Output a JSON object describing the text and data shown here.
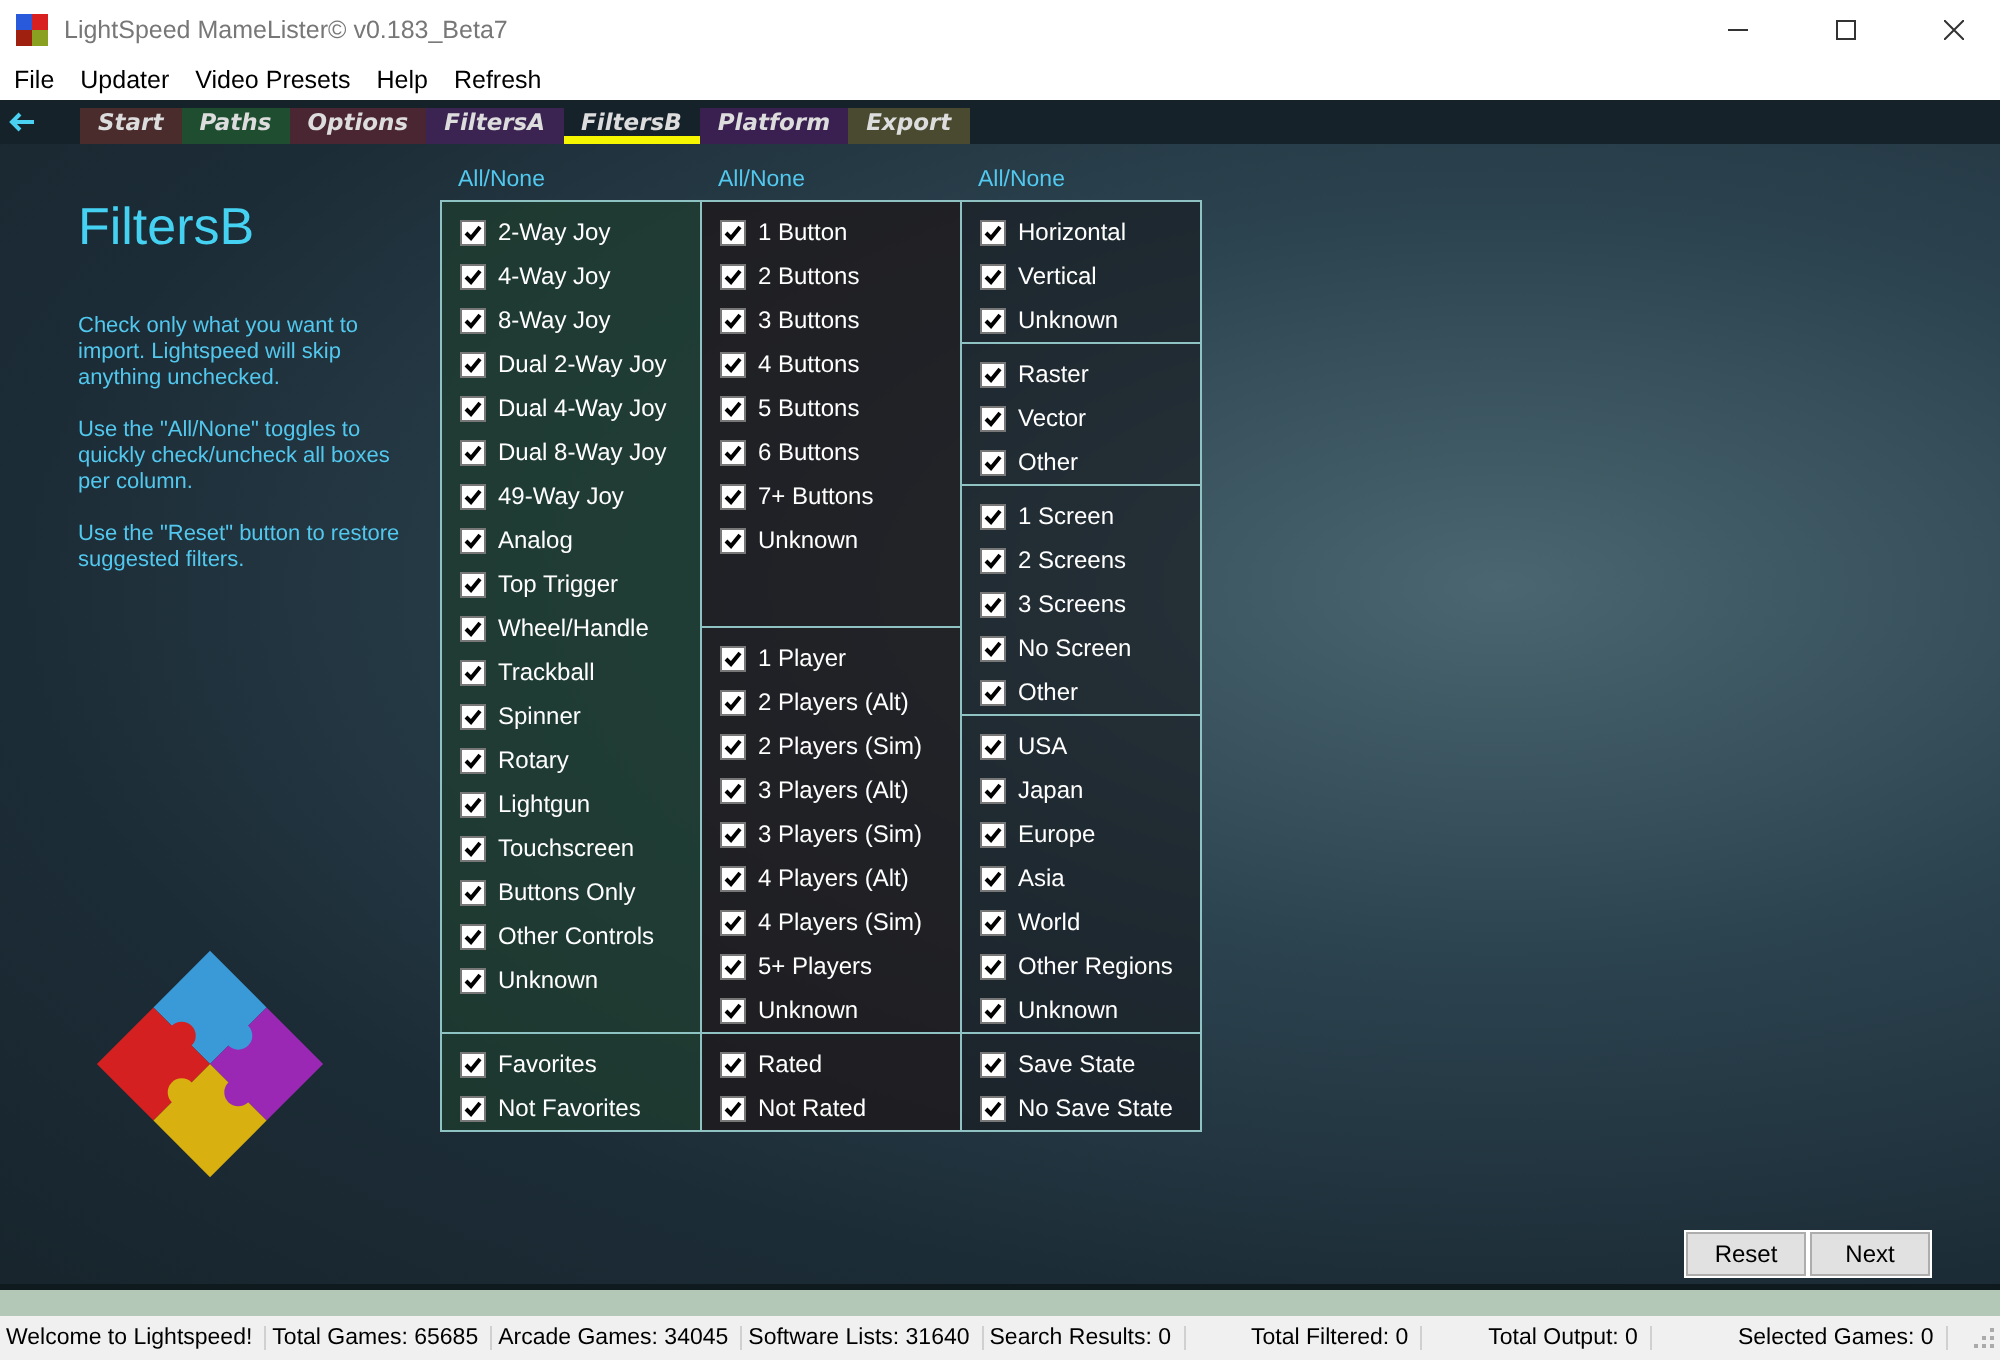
{
  "window": {
    "title": "LightSpeed MameLister© v0.183_Beta7"
  },
  "menu": [
    {
      "label": "File"
    },
    {
      "label": "Updater"
    },
    {
      "label": "Video Presets"
    },
    {
      "label": "Help"
    },
    {
      "label": "Refresh"
    }
  ],
  "tabs": [
    {
      "label": "Start",
      "selected": false,
      "color": "#4a2c2c"
    },
    {
      "label": "Paths",
      "selected": false,
      "color": "#1f4d30"
    },
    {
      "label": "Options",
      "selected": false,
      "color": "#4a2632"
    },
    {
      "label": "FiltersA",
      "selected": false,
      "color": "#3b2452"
    },
    {
      "label": "FiltersB",
      "selected": true
    },
    {
      "label": "Platform",
      "selected": false,
      "color": "#3a2050"
    },
    {
      "label": "Export",
      "selected": false,
      "color": "#4a4a30"
    }
  ],
  "page": {
    "title": "FiltersB",
    "help": [
      "Check only what you want to import. Lightspeed will skip anything unchecked.",
      "Use the \"All/None\" toggles to quickly check/uncheck all boxes per column.",
      "Use the \"Reset\" button to restore suggested filters."
    ]
  },
  "columns": [
    {
      "toggle": "All/None",
      "groups": [
        {
          "items": [
            {
              "label": "2-Way Joy",
              "checked": true
            },
            {
              "label": "4-Way Joy",
              "checked": true
            },
            {
              "label": "8-Way Joy",
              "checked": true
            },
            {
              "label": "Dual 2-Way Joy",
              "checked": true
            },
            {
              "label": "Dual 4-Way Joy",
              "checked": true
            },
            {
              "label": "Dual 8-Way Joy",
              "checked": true
            },
            {
              "label": "49-Way Joy",
              "checked": true
            },
            {
              "label": "Analog",
              "checked": true
            },
            {
              "label": "Top Trigger",
              "checked": true
            },
            {
              "label": "Wheel/Handle",
              "checked": true
            },
            {
              "label": "Trackball",
              "checked": true
            },
            {
              "label": "Spinner",
              "checked": true
            },
            {
              "label": "Rotary",
              "checked": true
            },
            {
              "label": "Lightgun",
              "checked": true
            },
            {
              "label": "Touchscreen",
              "checked": true
            },
            {
              "label": "Buttons Only",
              "checked": true
            },
            {
              "label": "Other Controls",
              "checked": true
            },
            {
              "label": "Unknown",
              "checked": true
            }
          ]
        },
        {
          "items": [
            {
              "label": "Favorites",
              "checked": true
            },
            {
              "label": "Not Favorites",
              "checked": true
            }
          ]
        }
      ]
    },
    {
      "toggle": "All/None",
      "groups": [
        {
          "items": [
            {
              "label": "1 Button",
              "checked": true
            },
            {
              "label": "2 Buttons",
              "checked": true
            },
            {
              "label": "3 Buttons",
              "checked": true
            },
            {
              "label": "4 Buttons",
              "checked": true
            },
            {
              "label": "5 Buttons",
              "checked": true
            },
            {
              "label": "6 Buttons",
              "checked": true
            },
            {
              "label": "7+ Buttons",
              "checked": true
            },
            {
              "label": "Unknown",
              "checked": true
            }
          ]
        },
        {
          "items": [
            {
              "label": "1 Player",
              "checked": true
            },
            {
              "label": "2 Players (Alt)",
              "checked": true
            },
            {
              "label": "2 Players (Sim)",
              "checked": true
            },
            {
              "label": "3 Players (Alt)",
              "checked": true
            },
            {
              "label": "3 Players (Sim)",
              "checked": true
            },
            {
              "label": "4 Players (Alt)",
              "checked": true
            },
            {
              "label": "4 Players (Sim)",
              "checked": true
            },
            {
              "label": "5+ Players",
              "checked": true
            },
            {
              "label": "Unknown",
              "checked": true
            }
          ]
        },
        {
          "items": [
            {
              "label": "Rated",
              "checked": true
            },
            {
              "label": "Not Rated",
              "checked": true
            }
          ]
        }
      ]
    },
    {
      "toggle": "All/None",
      "groups": [
        {
          "items": [
            {
              "label": "Horizontal",
              "checked": true
            },
            {
              "label": "Vertical",
              "checked": true
            },
            {
              "label": "Unknown",
              "checked": true
            }
          ]
        },
        {
          "items": [
            {
              "label": "Raster",
              "checked": true
            },
            {
              "label": "Vector",
              "checked": true
            },
            {
              "label": "Other",
              "checked": true
            }
          ]
        },
        {
          "items": [
            {
              "label": "1 Screen",
              "checked": true
            },
            {
              "label": "2 Screens",
              "checked": true
            },
            {
              "label": "3 Screens",
              "checked": true
            },
            {
              "label": "No Screen",
              "checked": true
            },
            {
              "label": "Other",
              "checked": true
            }
          ]
        },
        {
          "items": [
            {
              "label": "USA",
              "checked": true
            },
            {
              "label": "Japan",
              "checked": true
            },
            {
              "label": "Europe",
              "checked": true
            },
            {
              "label": "Asia",
              "checked": true
            },
            {
              "label": "World",
              "checked": true
            },
            {
              "label": "Other Regions",
              "checked": true
            },
            {
              "label": "Unknown",
              "checked": true
            }
          ]
        },
        {
          "items": [
            {
              "label": "Save State",
              "checked": true
            },
            {
              "label": "No Save State",
              "checked": true
            }
          ]
        }
      ]
    }
  ],
  "buttons": [
    {
      "label": "Reset"
    },
    {
      "label": "Next"
    }
  ],
  "status_bar": [
    "Welcome to Lightspeed!",
    "Total Games: 65685",
    "Arcade Games: 34045",
    "Software Lists: 31640",
    "Search Results: 0",
    "Total Filtered: 0",
    "Total Output: 0",
    "Selected Games: 0"
  ]
}
